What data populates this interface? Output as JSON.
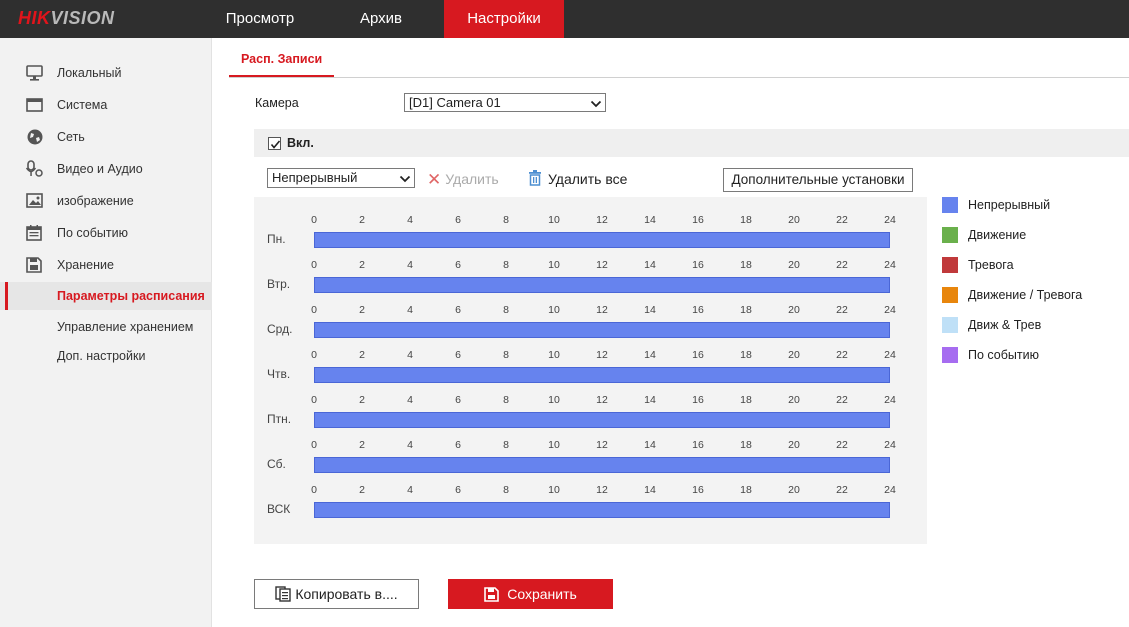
{
  "brand": {
    "part1": "HIK",
    "part2": "VISION"
  },
  "nav": [
    {
      "label": "Просмотр",
      "active": false
    },
    {
      "label": "Архив",
      "active": false
    },
    {
      "label": "Настройки",
      "active": true
    }
  ],
  "sidebar": {
    "items": [
      {
        "label": "Локальный",
        "icon": "monitor-icon"
      },
      {
        "label": "Система",
        "icon": "system-window-icon"
      },
      {
        "label": "Сеть",
        "icon": "globe-icon"
      },
      {
        "label": "Видео и Аудио",
        "icon": "microphone-icon"
      },
      {
        "label": "изображение",
        "icon": "image-icon"
      },
      {
        "label": "По событию",
        "icon": "calendar-icon"
      },
      {
        "label": "Хранение",
        "icon": "storage-icon"
      }
    ],
    "subitems": [
      {
        "label": "Параметры расписания",
        "active": true
      },
      {
        "label": "Управление хранением",
        "active": false
      },
      {
        "label": "Доп. настройки",
        "active": false
      }
    ]
  },
  "subtab": {
    "label": "Расп. Записи"
  },
  "camera": {
    "label": "Камера",
    "value": "[D1] Camera 01"
  },
  "enable": {
    "label": "Вкл.",
    "checked": true
  },
  "toolbar": {
    "type_value": "Непрерывный",
    "delete_label": "Удалить",
    "delete_all_label": "Удалить все",
    "advanced_label": "Дополнительные установки"
  },
  "schedule": {
    "ticks": [
      "0",
      "2",
      "4",
      "6",
      "8",
      "10",
      "12",
      "14",
      "16",
      "18",
      "20",
      "22",
      "24"
    ],
    "days": [
      {
        "label": "Пн.",
        "start": 0,
        "end": 24,
        "type": "Непрерывный"
      },
      {
        "label": "Втр.",
        "start": 0,
        "end": 24,
        "type": "Непрерывный"
      },
      {
        "label": "Срд.",
        "start": 0,
        "end": 24,
        "type": "Непрерывный"
      },
      {
        "label": "Чтв.",
        "start": 0,
        "end": 24,
        "type": "Непрерывный"
      },
      {
        "label": "Птн.",
        "start": 0,
        "end": 24,
        "type": "Непрерывный"
      },
      {
        "label": "Сб.",
        "start": 0,
        "end": 24,
        "type": "Непрерывный"
      },
      {
        "label": "ВСК",
        "start": 0,
        "end": 24,
        "type": "Непрерывный"
      }
    ]
  },
  "legend": [
    {
      "label": "Непрерывный",
      "color": "#6683ee"
    },
    {
      "label": "Движение",
      "color": "#6ab04c"
    },
    {
      "label": "Тревога",
      "color": "#c0393b"
    },
    {
      "label": "Движение / Тревога",
      "color": "#e8860c"
    },
    {
      "label": "Движ & Трев",
      "color": "#bfe0f7"
    },
    {
      "label": "По событию",
      "color": "#a66cf0"
    }
  ],
  "buttons": {
    "copy_label": "Копировать в....",
    "save_label": "Сохранить"
  }
}
